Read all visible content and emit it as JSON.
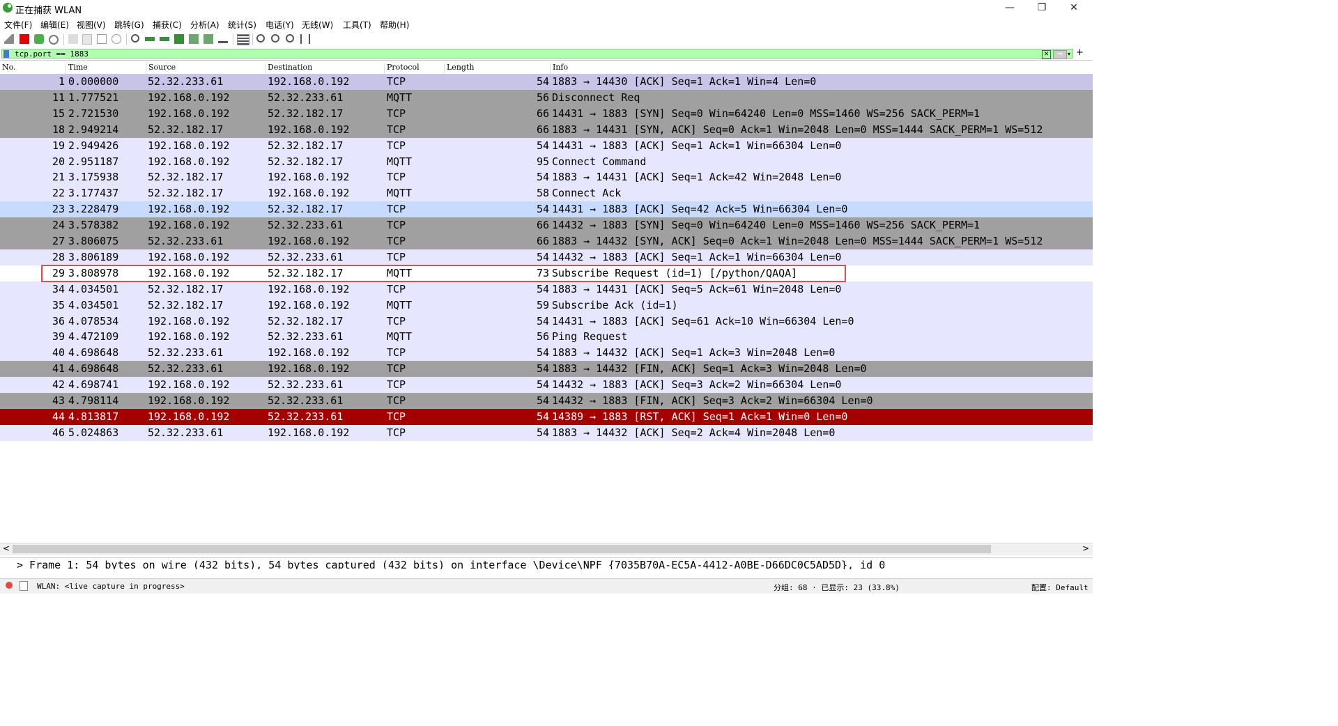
{
  "window": {
    "title": "正在捕获 WLAN",
    "minimize": "—",
    "restore": "❐",
    "close": "✕"
  },
  "menu": [
    "文件(F)",
    "编辑(E)",
    "视图(V)",
    "跳转(G)",
    "捕获(C)",
    "分析(A)",
    "统计(S)",
    "电话(Y)",
    "无线(W)",
    "工具(T)",
    "帮助(H)"
  ],
  "filter": {
    "value": "tcp.port == 1883",
    "clear": "✕",
    "apply": "⇒",
    "dropdown": "▾",
    "add": "+"
  },
  "columns": [
    "No.",
    "Time",
    "Source",
    "Destination",
    "Protocol",
    "Length",
    "Info"
  ],
  "colors": {
    "purple": "#e7e6ff",
    "purple_dark": "#c8c4e8",
    "gray": "#a0a0a0",
    "blue": "#c6dbff",
    "red": "#a40000",
    "white": "#ffffff"
  },
  "packets": [
    {
      "no": "1",
      "time": "0.000000",
      "src": "52.32.233.61",
      "dst": "192.168.0.192",
      "proto": "TCP",
      "len": "54",
      "info": "1883 → 14430 [ACK] Seq=1 Ack=1 Win=4 Len=0",
      "color": "purple_dark"
    },
    {
      "no": "11",
      "time": "1.777521",
      "src": "192.168.0.192",
      "dst": "52.32.233.61",
      "proto": "MQTT",
      "len": "56",
      "info": "Disconnect Req",
      "color": "gray"
    },
    {
      "no": "15",
      "time": "2.721530",
      "src": "192.168.0.192",
      "dst": "52.32.182.17",
      "proto": "TCP",
      "len": "66",
      "info": "14431 → 1883 [SYN] Seq=0 Win=64240 Len=0 MSS=1460 WS=256 SACK_PERM=1",
      "color": "gray"
    },
    {
      "no": "18",
      "time": "2.949214",
      "src": "52.32.182.17",
      "dst": "192.168.0.192",
      "proto": "TCP",
      "len": "66",
      "info": "1883 → 14431 [SYN, ACK] Seq=0 Ack=1 Win=2048 Len=0 MSS=1444 SACK_PERM=1 WS=512",
      "color": "gray"
    },
    {
      "no": "19",
      "time": "2.949426",
      "src": "192.168.0.192",
      "dst": "52.32.182.17",
      "proto": "TCP",
      "len": "54",
      "info": "14431 → 1883 [ACK] Seq=1 Ack=1 Win=66304 Len=0",
      "color": "purple"
    },
    {
      "no": "20",
      "time": "2.951187",
      "src": "192.168.0.192",
      "dst": "52.32.182.17",
      "proto": "MQTT",
      "len": "95",
      "info": "Connect Command",
      "color": "purple"
    },
    {
      "no": "21",
      "time": "3.175938",
      "src": "52.32.182.17",
      "dst": "192.168.0.192",
      "proto": "TCP",
      "len": "54",
      "info": "1883 → 14431 [ACK] Seq=1 Ack=42 Win=2048 Len=0",
      "color": "purple"
    },
    {
      "no": "22",
      "time": "3.177437",
      "src": "52.32.182.17",
      "dst": "192.168.0.192",
      "proto": "MQTT",
      "len": "58",
      "info": "Connect Ack",
      "color": "purple"
    },
    {
      "no": "23",
      "time": "3.228479",
      "src": "192.168.0.192",
      "dst": "52.32.182.17",
      "proto": "TCP",
      "len": "54",
      "info": "14431 → 1883 [ACK] Seq=42 Ack=5 Win=66304 Len=0",
      "color": "blue"
    },
    {
      "no": "24",
      "time": "3.578382",
      "src": "192.168.0.192",
      "dst": "52.32.233.61",
      "proto": "TCP",
      "len": "66",
      "info": "14432 → 1883 [SYN] Seq=0 Win=64240 Len=0 MSS=1460 WS=256 SACK_PERM=1",
      "color": "gray"
    },
    {
      "no": "27",
      "time": "3.806075",
      "src": "52.32.233.61",
      "dst": "192.168.0.192",
      "proto": "TCP",
      "len": "66",
      "info": "1883 → 14432 [SYN, ACK] Seq=0 Ack=1 Win=2048 Len=0 MSS=1444 SACK_PERM=1 WS=512",
      "color": "gray"
    },
    {
      "no": "28",
      "time": "3.806189",
      "src": "192.168.0.192",
      "dst": "52.32.233.61",
      "proto": "TCP",
      "len": "54",
      "info": "14432 → 1883 [ACK] Seq=1 Ack=1 Win=66304 Len=0",
      "color": "purple"
    },
    {
      "no": "29",
      "time": "3.808978",
      "src": "192.168.0.192",
      "dst": "52.32.182.17",
      "proto": "MQTT",
      "len": "73",
      "info": "Subscribe Request (id=1) [/python/QAQA]",
      "color": "white"
    },
    {
      "no": "34",
      "time": "4.034501",
      "src": "52.32.182.17",
      "dst": "192.168.0.192",
      "proto": "TCP",
      "len": "54",
      "info": "1883 → 14431 [ACK] Seq=5 Ack=61 Win=2048 Len=0",
      "color": "purple"
    },
    {
      "no": "35",
      "time": "4.034501",
      "src": "52.32.182.17",
      "dst": "192.168.0.192",
      "proto": "MQTT",
      "len": "59",
      "info": "Subscribe Ack (id=1)",
      "color": "purple"
    },
    {
      "no": "36",
      "time": "4.078534",
      "src": "192.168.0.192",
      "dst": "52.32.182.17",
      "proto": "TCP",
      "len": "54",
      "info": "14431 → 1883 [ACK] Seq=61 Ack=10 Win=66304 Len=0",
      "color": "purple"
    },
    {
      "no": "39",
      "time": "4.472109",
      "src": "192.168.0.192",
      "dst": "52.32.233.61",
      "proto": "MQTT",
      "len": "56",
      "info": "Ping Request",
      "color": "purple"
    },
    {
      "no": "40",
      "time": "4.698648",
      "src": "52.32.233.61",
      "dst": "192.168.0.192",
      "proto": "TCP",
      "len": "54",
      "info": "1883 → 14432 [ACK] Seq=1 Ack=3 Win=2048 Len=0",
      "color": "purple"
    },
    {
      "no": "41",
      "time": "4.698648",
      "src": "52.32.233.61",
      "dst": "192.168.0.192",
      "proto": "TCP",
      "len": "54",
      "info": "1883 → 14432 [FIN, ACK] Seq=1 Ack=3 Win=2048 Len=0",
      "color": "gray"
    },
    {
      "no": "42",
      "time": "4.698741",
      "src": "192.168.0.192",
      "dst": "52.32.233.61",
      "proto": "TCP",
      "len": "54",
      "info": "14432 → 1883 [ACK] Seq=3 Ack=2 Win=66304 Len=0",
      "color": "purple"
    },
    {
      "no": "43",
      "time": "4.798114",
      "src": "192.168.0.192",
      "dst": "52.32.233.61",
      "proto": "TCP",
      "len": "54",
      "info": "14432 → 1883 [FIN, ACK] Seq=3 Ack=2 Win=66304 Len=0",
      "color": "gray"
    },
    {
      "no": "44",
      "time": "4.813817",
      "src": "192.168.0.192",
      "dst": "52.32.233.61",
      "proto": "TCP",
      "len": "54",
      "info": "14389 → 1883 [RST, ACK] Seq=1 Ack=1 Win=0 Len=0",
      "color": "red"
    },
    {
      "no": "46",
      "time": "5.024863",
      "src": "52.32.233.61",
      "dst": "192.168.0.192",
      "proto": "TCP",
      "len": "54",
      "info": "1883 → 14432 [ACK] Seq=2 Ack=4 Win=2048 Len=0",
      "color": "purple"
    }
  ],
  "detail": "> Frame 1: 54 bytes on wire (432 bits), 54 bytes captured (432 bits) on interface \\Device\\NPF_{7035B70A-EC5A-4412-A0BE-D66DC0C5AD5D}, id 0",
  "status": {
    "interface": "WLAN: <live capture in progress>",
    "packets": "分组: 68 · 已显示: 23 (33.8%)",
    "profile": "配置: Default"
  },
  "scroll": {
    "left": "<",
    "right": ">"
  }
}
